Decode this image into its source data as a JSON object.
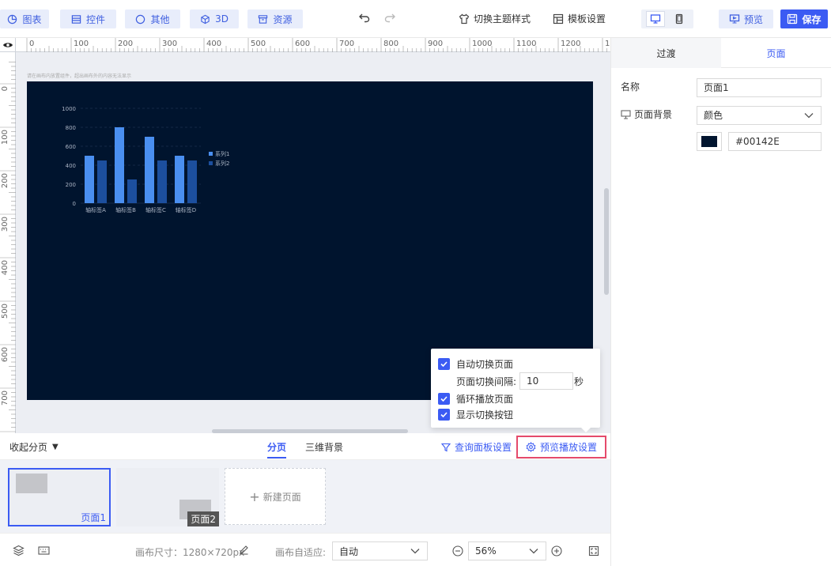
{
  "toolbar": {
    "chart_label": "图表",
    "control_label": "控件",
    "other_label": "其他",
    "threed_label": "3D",
    "resource_label": "资源",
    "theme_label": "切换主题样式",
    "template_label": "模板设置",
    "preview_label": "预览",
    "save_label": "保存"
  },
  "canvas": {
    "hint": "请在画布内放置组件，超出画布外的内容无法显示",
    "ruler_h": [
      "0",
      "100",
      "200",
      "300",
      "400",
      "500",
      "600",
      "700",
      "800",
      "900",
      "1000",
      "1100",
      "1200",
      "1"
    ],
    "ruler_v": [
      "0",
      "100",
      "200",
      "300",
      "400",
      "500",
      "600",
      "700"
    ],
    "background_color": "#00142E"
  },
  "chart_data": {
    "type": "bar",
    "categories": [
      "轴标签A",
      "轴标签B",
      "轴标签C",
      "轴标签D"
    ],
    "series": [
      {
        "name": "系列1",
        "values": [
          500,
          800,
          700,
          500
        ],
        "color": "#4a8ff0"
      },
      {
        "name": "系列2",
        "values": [
          450,
          250,
          450,
          450
        ],
        "color": "#1c4f9e"
      }
    ],
    "yticks": [
      "0",
      "200",
      "400",
      "600",
      "800",
      "1000"
    ],
    "ylim": [
      0,
      1000
    ],
    "legend": "right"
  },
  "popover": {
    "auto_switch": "自动切换页面",
    "interval_label": "页面切换间隔:",
    "interval_value": "10",
    "interval_unit": "秒",
    "loop": "循环播放页面",
    "show_buttons": "显示切换按钮"
  },
  "pager": {
    "collapse_label": "收起分页",
    "tab_pages": "分页",
    "tab_3d": "三维背景",
    "query_panel": "查询面板设置",
    "preview_settings": "预览播放设置"
  },
  "pages": {
    "page1": "页面1",
    "page2": "页面2",
    "new_page": "新建页面"
  },
  "bottom": {
    "canvas_size": "画布尺寸：1280×720px",
    "fit_label": "画布自适应:",
    "fit_value": "自动",
    "zoom": "56%"
  },
  "right_panel": {
    "tab_transition": "过渡",
    "tab_page": "页面",
    "name_label": "名称",
    "name_value": "页面1",
    "bg_label": "页面背景",
    "bg_type": "颜色",
    "bg_color": "#00142E"
  }
}
